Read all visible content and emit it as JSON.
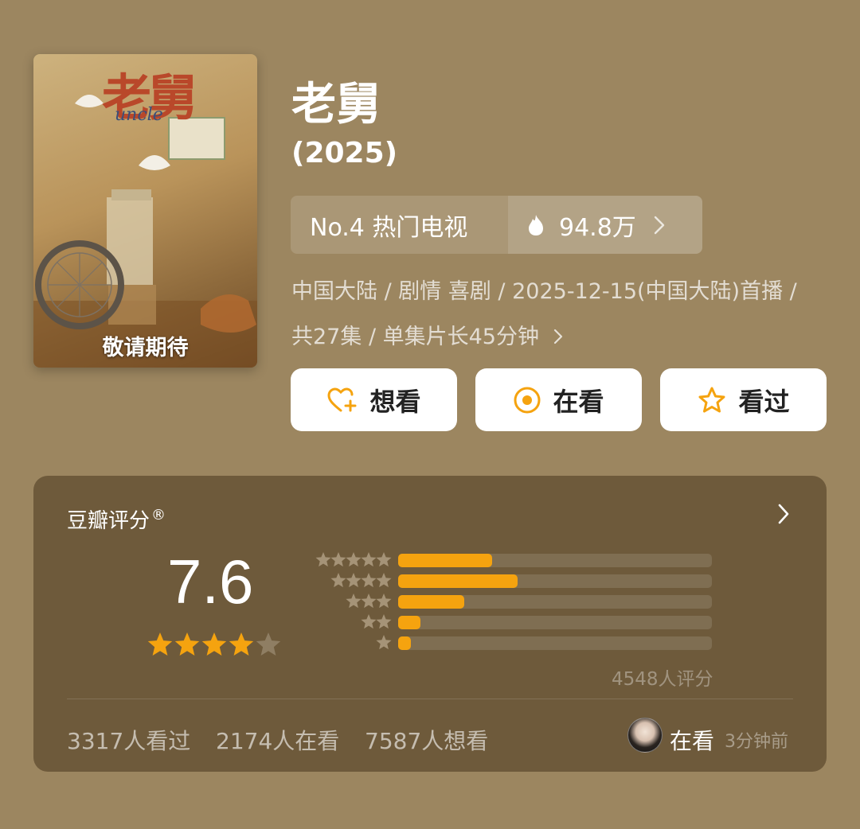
{
  "poster": {
    "title_art": "老舅",
    "subtitle_art": "uncle",
    "caption": "敬请期待"
  },
  "show": {
    "title": "老舅",
    "year": "(2025)"
  },
  "ranking": {
    "rank_label": "No.4 热门电视",
    "heat": "94.8万",
    "chevron": "chevron-right-icon"
  },
  "meta": {
    "line1": "中国大陆 / 剧情 喜剧 / 2025-12-15(中国大陆)首播 /",
    "line2": "共27集 / 单集片长45分钟"
  },
  "actions": {
    "want_label": "想看",
    "watching_label": "在看",
    "watched_label": "看过",
    "accent_color": "#f5a30f"
  },
  "rating": {
    "title": "豆瓣评分",
    "registered_mark": "®",
    "score": "7.6",
    "avg_stars": 4,
    "total_label": "4548人评分",
    "distribution": [
      {
        "stars": 5,
        "share": 0.3
      },
      {
        "stars": 4,
        "share": 0.38
      },
      {
        "stars": 3,
        "share": 0.21
      },
      {
        "stars": 2,
        "share": 0.07
      },
      {
        "stars": 1,
        "share": 0.04
      }
    ],
    "bar_color": "#f5a30f"
  },
  "stats": {
    "watched": "3317人看过",
    "watching": "2174人在看",
    "want": "7587人想看"
  },
  "friend": {
    "status": "在看",
    "time": "3分钟前"
  }
}
